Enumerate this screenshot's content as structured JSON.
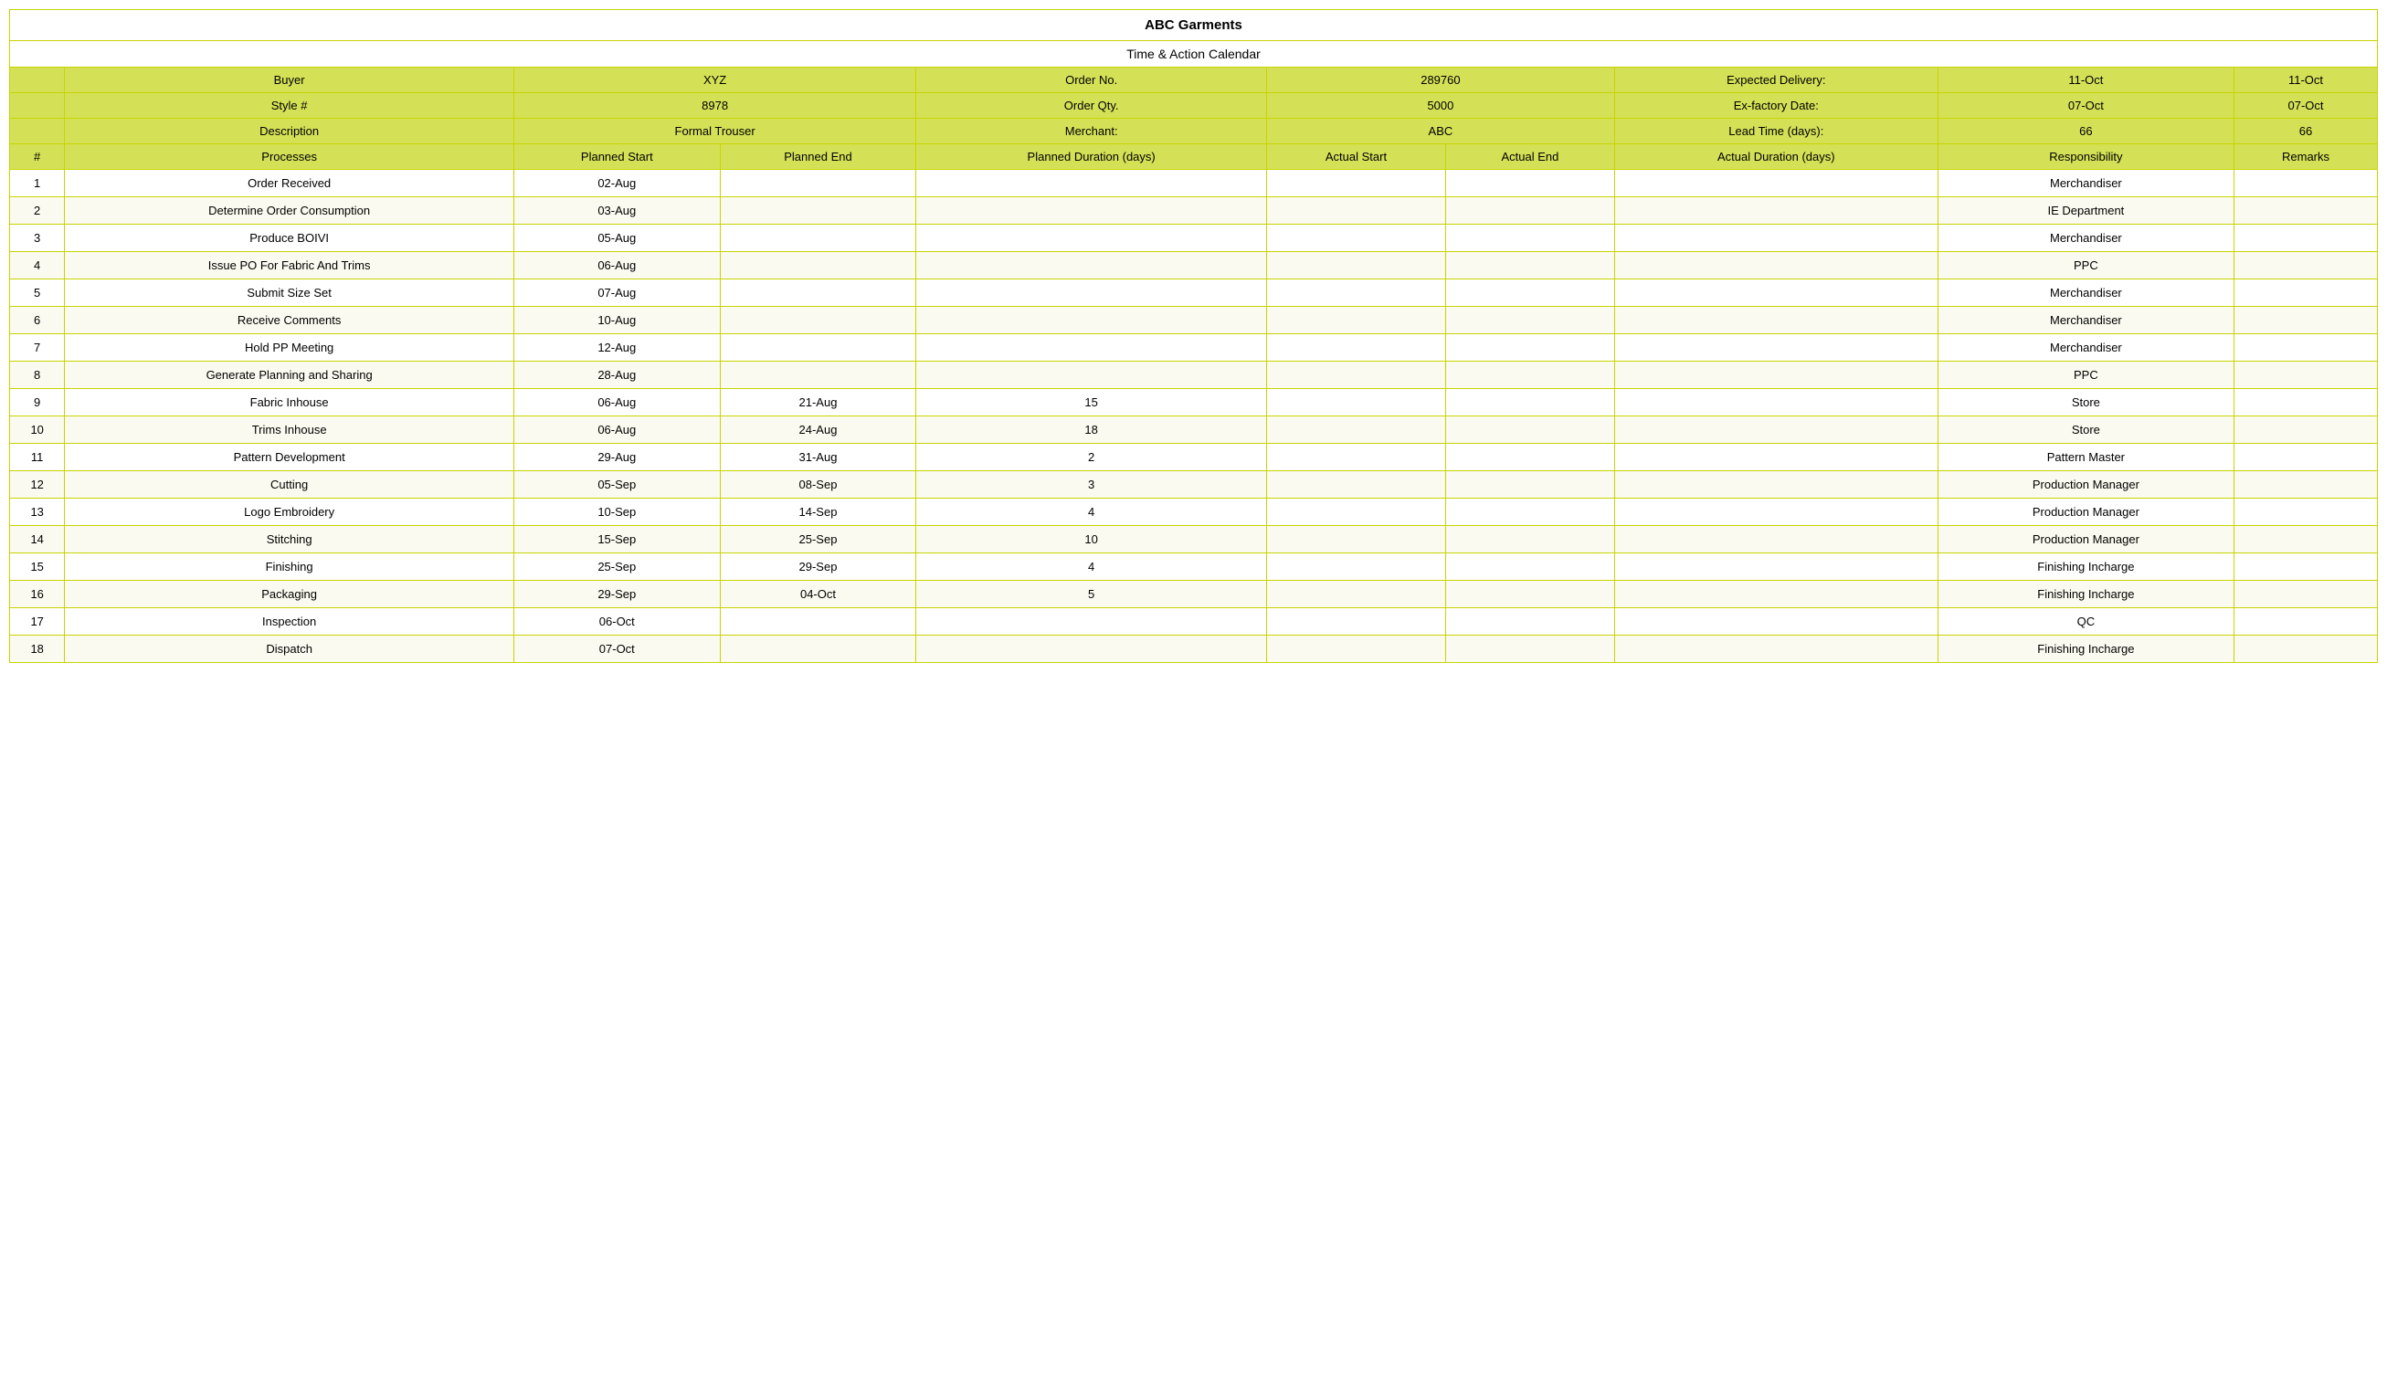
{
  "title": "ABC Garments",
  "subtitle": "Time & Action Calendar",
  "info": {
    "buyer_label": "Buyer",
    "buyer_value": "XYZ",
    "order_no_label": "Order No.",
    "order_no_value": "289760",
    "expected_delivery_label": "Expected Delivery:",
    "expected_delivery_value": "11-Oct",
    "style_label": "Style #",
    "style_value": "8978",
    "order_qty_label": "Order Qty.",
    "order_qty_value": "5000",
    "exfactory_label": "Ex-factory Date:",
    "exfactory_value": "07-Oct",
    "description_label": "Description",
    "description_value": "Formal Trouser",
    "merchant_label": "Merchant:",
    "merchant_value": "ABC",
    "lead_time_label": "Lead Time (days):",
    "lead_time_value": "66"
  },
  "columns": {
    "hash": "#",
    "processes": "Processes",
    "planned_start": "Planned Start",
    "planned_end": "Planned End",
    "planned_duration": "Planned Duration (days)",
    "actual_start": "Actual Start",
    "actual_end": "Actual End",
    "actual_duration": "Actual Duration (days)",
    "responsibility": "Responsibility",
    "remarks": "Remarks"
  },
  "rows": [
    {
      "num": "1",
      "process": "Order Received",
      "p_start": "02-Aug",
      "p_end": "",
      "p_dur": "",
      "a_start": "",
      "a_end": "",
      "a_dur": "",
      "responsibility": "Merchandiser",
      "remarks": ""
    },
    {
      "num": "2",
      "process": "Determine Order Consumption",
      "p_start": "03-Aug",
      "p_end": "",
      "p_dur": "",
      "a_start": "",
      "a_end": "",
      "a_dur": "",
      "responsibility": "IE Department",
      "remarks": ""
    },
    {
      "num": "3",
      "process": "Produce BOIVI",
      "p_start": "05-Aug",
      "p_end": "",
      "p_dur": "",
      "a_start": "",
      "a_end": "",
      "a_dur": "",
      "responsibility": "Merchandiser",
      "remarks": ""
    },
    {
      "num": "4",
      "process": "Issue PO For Fabric And Trims",
      "p_start": "06-Aug",
      "p_end": "",
      "p_dur": "",
      "a_start": "",
      "a_end": "",
      "a_dur": "",
      "responsibility": "PPC",
      "remarks": ""
    },
    {
      "num": "5",
      "process": "Submit Size Set",
      "p_start": "07-Aug",
      "p_end": "",
      "p_dur": "",
      "a_start": "",
      "a_end": "",
      "a_dur": "",
      "responsibility": "Merchandiser",
      "remarks": ""
    },
    {
      "num": "6",
      "process": "Receive Comments",
      "p_start": "10-Aug",
      "p_end": "",
      "p_dur": "",
      "a_start": "",
      "a_end": "",
      "a_dur": "",
      "responsibility": "Merchandiser",
      "remarks": ""
    },
    {
      "num": "7",
      "process": "Hold PP Meeting",
      "p_start": "12-Aug",
      "p_end": "",
      "p_dur": "",
      "a_start": "",
      "a_end": "",
      "a_dur": "",
      "responsibility": "Merchandiser",
      "remarks": ""
    },
    {
      "num": "8",
      "process": "Generate Planning and Sharing",
      "p_start": "28-Aug",
      "p_end": "",
      "p_dur": "",
      "a_start": "",
      "a_end": "",
      "a_dur": "",
      "responsibility": "PPC",
      "remarks": ""
    },
    {
      "num": "9",
      "process": "Fabric Inhouse",
      "p_start": "06-Aug",
      "p_end": "21-Aug",
      "p_dur": "15",
      "a_start": "",
      "a_end": "",
      "a_dur": "",
      "responsibility": "Store",
      "remarks": ""
    },
    {
      "num": "10",
      "process": "Trims Inhouse",
      "p_start": "06-Aug",
      "p_end": "24-Aug",
      "p_dur": "18",
      "a_start": "",
      "a_end": "",
      "a_dur": "",
      "responsibility": "Store",
      "remarks": ""
    },
    {
      "num": "11",
      "process": "Pattern Development",
      "p_start": "29-Aug",
      "p_end": "31-Aug",
      "p_dur": "2",
      "a_start": "",
      "a_end": "",
      "a_dur": "",
      "responsibility": "Pattern Master",
      "remarks": ""
    },
    {
      "num": "12",
      "process": "Cutting",
      "p_start": "05-Sep",
      "p_end": "08-Sep",
      "p_dur": "3",
      "a_start": "",
      "a_end": "",
      "a_dur": "",
      "responsibility": "Production Manager",
      "remarks": ""
    },
    {
      "num": "13",
      "process": "Logo Embroidery",
      "p_start": "10-Sep",
      "p_end": "14-Sep",
      "p_dur": "4",
      "a_start": "",
      "a_end": "",
      "a_dur": "",
      "responsibility": "Production Manager",
      "remarks": ""
    },
    {
      "num": "14",
      "process": "Stitching",
      "p_start": "15-Sep",
      "p_end": "25-Sep",
      "p_dur": "10",
      "a_start": "",
      "a_end": "",
      "a_dur": "",
      "responsibility": "Production Manager",
      "remarks": ""
    },
    {
      "num": "15",
      "process": "Finishing",
      "p_start": "25-Sep",
      "p_end": "29-Sep",
      "p_dur": "4",
      "a_start": "",
      "a_end": "",
      "a_dur": "",
      "responsibility": "Finishing Incharge",
      "remarks": ""
    },
    {
      "num": "16",
      "process": "Packaging",
      "p_start": "29-Sep",
      "p_end": "04-Oct",
      "p_dur": "5",
      "a_start": "",
      "a_end": "",
      "a_dur": "",
      "responsibility": "Finishing Incharge",
      "remarks": ""
    },
    {
      "num": "17",
      "process": "Inspection",
      "p_start": "06-Oct",
      "p_end": "",
      "p_dur": "",
      "a_start": "",
      "a_end": "",
      "a_dur": "",
      "responsibility": "QC",
      "remarks": ""
    },
    {
      "num": "18",
      "process": "Dispatch",
      "p_start": "07-Oct",
      "p_end": "",
      "p_dur": "",
      "a_start": "",
      "a_end": "",
      "a_dur": "",
      "responsibility": "Finishing Incharge",
      "remarks": ""
    }
  ]
}
